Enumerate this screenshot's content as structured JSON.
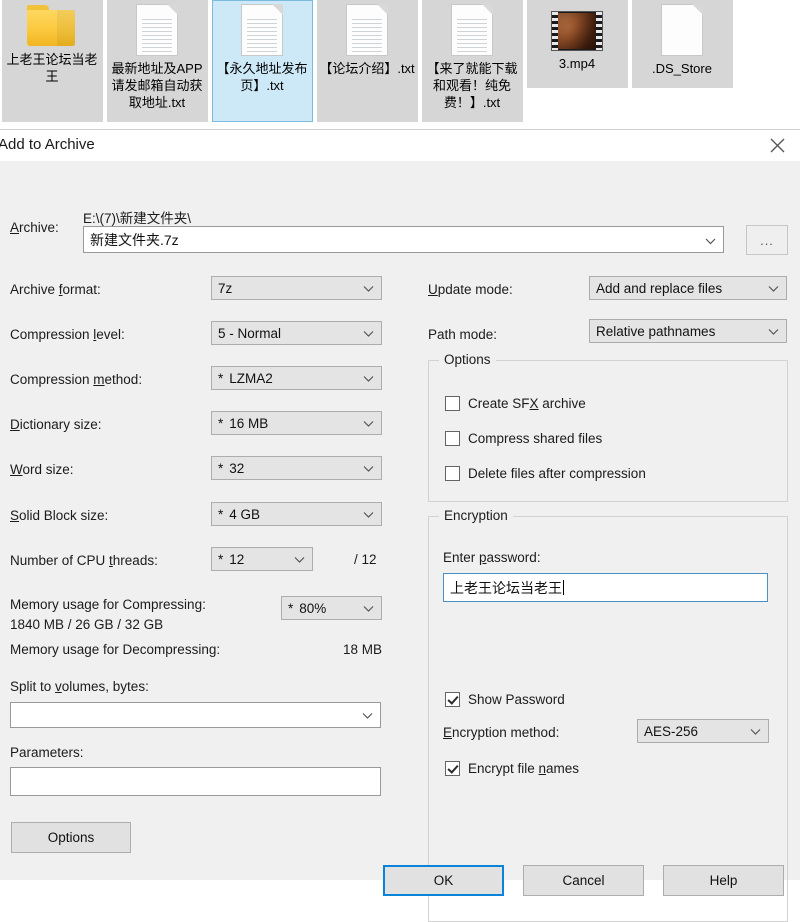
{
  "explorer": {
    "files": [
      {
        "name": "上老王论坛当老王",
        "icon": "folder-icon",
        "selected": false
      },
      {
        "name": "最新地址及APP请发邮箱自动获取地址.txt",
        "icon": "text-document-icon",
        "selected": false
      },
      {
        "name": "【永久地址发布页】.txt",
        "icon": "text-document-icon",
        "selected": true
      },
      {
        "name": "【论坛介绍】.txt",
        "icon": "text-document-icon",
        "selected": false
      },
      {
        "name": "【来了就能下载和观看！纯免费！】.txt",
        "icon": "text-document-icon",
        "selected": false
      },
      {
        "name": "3.mp4",
        "icon": "video-file-icon",
        "selected": false
      },
      {
        "name": ".DS_Store",
        "icon": "blank-document-icon",
        "selected": false
      }
    ]
  },
  "dialog": {
    "title": "Add to Archive",
    "close_label": "×",
    "archive": {
      "label": "Archive:",
      "label_accel": "A",
      "path": "E:\\(7)\\新建文件夹\\",
      "value": "新建文件夹.7z",
      "browse_label": "..."
    },
    "left_fields": [
      {
        "label": "Archive format:",
        "accel": "f",
        "value": "7z",
        "star": false
      },
      {
        "label": "Compression level:",
        "accel": "l",
        "value": "5 - Normal",
        "star": false
      },
      {
        "label": "Compression method:",
        "accel": "m",
        "value": "LZMA2",
        "star": true
      },
      {
        "label": "Dictionary size:",
        "accel": "D",
        "value": "16 MB",
        "star": true
      },
      {
        "label": "Word size:",
        "accel": "W",
        "value": "32",
        "star": true
      },
      {
        "label": "Solid Block size:",
        "accel": "S",
        "value": "4 GB",
        "star": true
      }
    ],
    "cpu": {
      "label": "Number of CPU threads:",
      "accel": "t",
      "value": "12",
      "star": true,
      "total": "/ 12"
    },
    "memory": {
      "compress_label": "Memory usage for Compressing:",
      "compress_detail": "1840 MB / 26 GB / 32 GB",
      "compress_value": "80%",
      "compress_star": true,
      "decompress_label": "Memory usage for Decompressing:",
      "decompress_value": "18 MB"
    },
    "split": {
      "label": "Split to volumes, bytes:",
      "accel": "v",
      "value": "",
      "placeholder": ""
    },
    "parameters": {
      "label": "Parameters:",
      "value": "",
      "placeholder": ""
    },
    "right_fields": [
      {
        "label": "Update mode:",
        "accel": "U",
        "value": "Add and replace files"
      },
      {
        "label": "Path mode:",
        "accel": "",
        "value": "Relative pathnames"
      }
    ],
    "options_group": {
      "caption": "Options",
      "items": [
        {
          "label": "Create SFX archive",
          "accel": "X",
          "checked": false
        },
        {
          "label": "Compress shared files",
          "accel": "",
          "checked": false
        },
        {
          "label": "Delete files after compression",
          "accel": "",
          "checked": false
        }
      ]
    },
    "encryption_group": {
      "caption": "Encryption",
      "password_label": "Enter password:",
      "password_accel": "p",
      "password_value": "上老王论坛当老王",
      "show_password": {
        "label": "Show Password",
        "checked": true
      },
      "method_label": "Encryption method:",
      "method_accel": "E",
      "method_value": "AES-256",
      "encrypt_names": {
        "label": "Encrypt file names",
        "accel": "n",
        "checked": true
      }
    },
    "buttons": {
      "options": "Options",
      "ok": "OK",
      "cancel": "Cancel",
      "help": "Help"
    }
  },
  "colors": {
    "dialog_bg": "#f0f0f0",
    "titlebar_bg": "#ffffff",
    "selection_blue": "#cde8f7",
    "focus_blue": "#0a84d8",
    "field_bg": "#e4e4e4"
  }
}
